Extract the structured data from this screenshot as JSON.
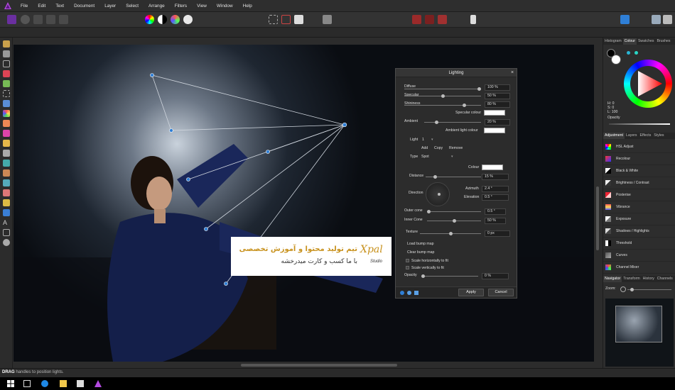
{
  "menubar": {
    "items": [
      "File",
      "Edit",
      "Text",
      "Document",
      "Layer",
      "Select",
      "Arrange",
      "Filters",
      "View",
      "Window",
      "Help"
    ]
  },
  "status": {
    "bold": "DRAG",
    "text": " handles to position lights."
  },
  "dialog": {
    "title": "Lighting",
    "diffuse": {
      "label": "Diffuse",
      "value": "100 %",
      "level": 1.0
    },
    "specular": {
      "label": "Specular",
      "value": "50 %",
      "level": 0.5
    },
    "shininess": {
      "label": "Shininess",
      "value": "80 %",
      "level": 0.8
    },
    "specular_colour": "Specular colour",
    "ambient": {
      "label": "Ambient",
      "value": "20 %",
      "level": 0.2
    },
    "ambient_colour": "Ambient light colour",
    "light_label": "Light",
    "light_value": "1",
    "add": "Add",
    "copy": "Copy",
    "remove": "Remove",
    "type_label": "Type",
    "type_value": "Spot",
    "colour": "Colour",
    "distance": {
      "label": "Distance",
      "value": "15 %",
      "level": 0.15
    },
    "direction": "Direction",
    "azimuth": {
      "label": "Azimuth",
      "value": "2.4 °"
    },
    "elevation": {
      "label": "Elevation",
      "value": "0.5 °"
    },
    "outer_cone": {
      "label": "Outer cone",
      "value": "0.5 °",
      "level": 0.0
    },
    "inner_cone": {
      "label": "Inner Cone",
      "value": "50 %",
      "level": 0.5
    },
    "texture": {
      "label": "Texture",
      "value": "0 px",
      "level": 0.5
    },
    "load_bump": "Load bump map",
    "clear_bump": "Clear bump map",
    "scale_h": "Scale horizontally to fit",
    "scale_v": "Scale vertically to fit",
    "opacity": {
      "label": "Opacity",
      "value": "0 %",
      "level": 0.0
    },
    "apply": "Apply",
    "cancel": "Cancel"
  },
  "panel": {
    "top_tabs": [
      "Histogram",
      "Colour",
      "Swatches",
      "Brushes"
    ],
    "hsl": [
      "H: 0",
      "S: 0",
      "L: 100"
    ],
    "opacity_label": "Opacity",
    "mid_tabs": [
      "Adjustment",
      "Layers",
      "Effects",
      "Styles"
    ],
    "adjustments": [
      {
        "label": "HSL Adjust",
        "icon": "hsl-icon"
      },
      {
        "label": "Recolour",
        "icon": "recolour-icon"
      },
      {
        "label": "Black & White",
        "icon": "black-white-icon"
      },
      {
        "label": "Brightness / Contrast",
        "icon": "brightness-icon"
      },
      {
        "label": "Posterise",
        "icon": "posterise-icon"
      },
      {
        "label": "Vibrance",
        "icon": "vibrance-icon"
      },
      {
        "label": "Exposure",
        "icon": "exposure-icon"
      },
      {
        "label": "Shadows / Highlights",
        "icon": "shadows-icon"
      },
      {
        "label": "Threshold",
        "icon": "threshold-icon"
      },
      {
        "label": "Curves",
        "icon": "curves-icon"
      },
      {
        "label": "Channel Mixer",
        "icon": "channel-mixer-icon"
      }
    ],
    "bottom_tabs": [
      "Navigator",
      "Transform",
      "History",
      "Channels"
    ],
    "zoom_label": "Zoom:"
  },
  "watermark": {
    "line1": "تیم تولید محتوا و آموزش تخصصی",
    "line2": "با ما کسب و کارت میدرخشه",
    "brand": "Xpal",
    "brand_sub": "Studio"
  },
  "colors": {
    "accent": "#2f7fd6",
    "affinity": "#9b3fd6",
    "dialog_bg": "#2c2c2c"
  }
}
